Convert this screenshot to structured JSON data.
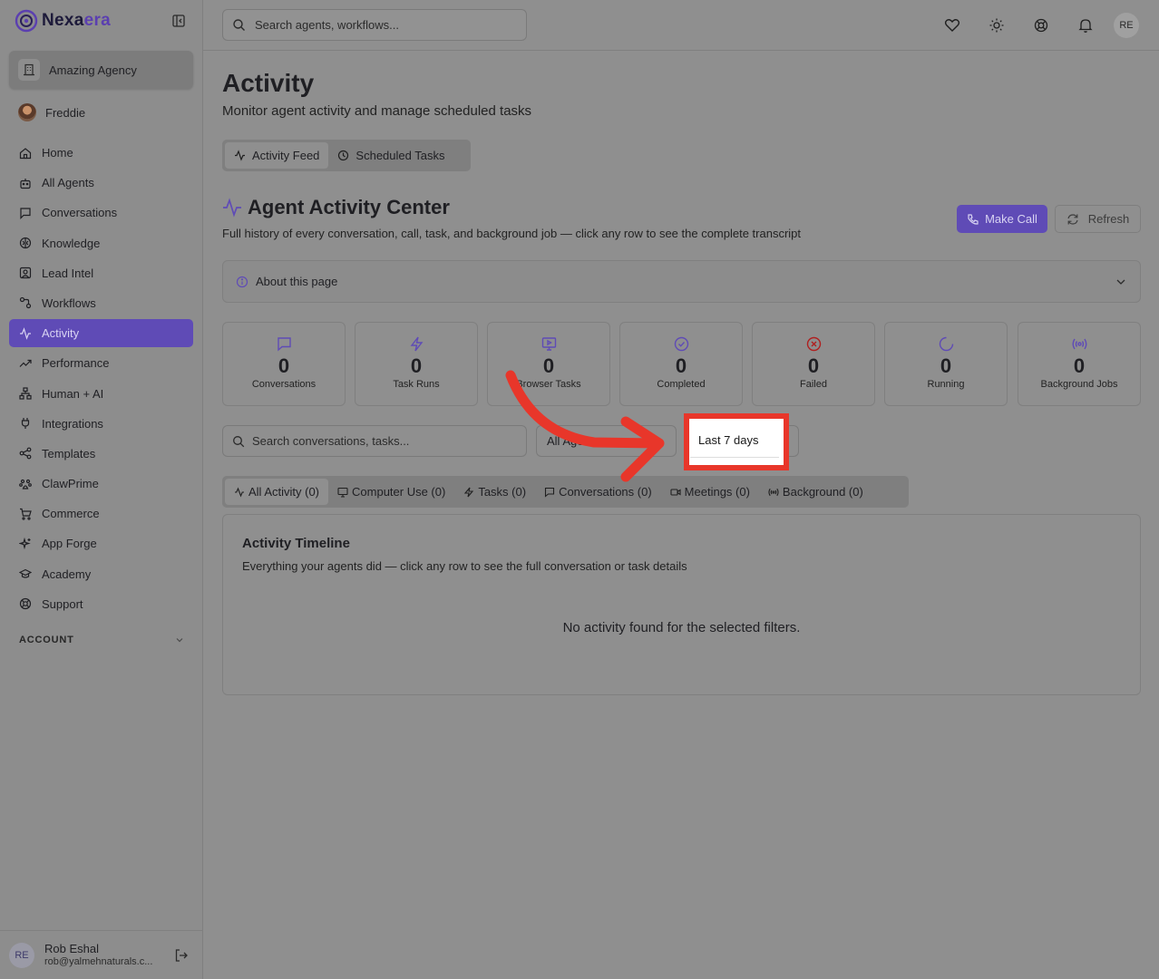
{
  "brand": {
    "name_part1": "Nexa",
    "name_part2": "era",
    "accent": "#5f4bb6"
  },
  "sidebar": {
    "agency_label": "Amazing Agency",
    "user_name": "Freddie",
    "items": [
      {
        "label": "Home",
        "icon": "home-icon"
      },
      {
        "label": "All Agents",
        "icon": "bot-icon"
      },
      {
        "label": "Conversations",
        "icon": "message-icon"
      },
      {
        "label": "Knowledge",
        "icon": "brain-icon"
      },
      {
        "label": "Lead Intel",
        "icon": "contact-icon"
      },
      {
        "label": "Workflows",
        "icon": "workflow-icon"
      },
      {
        "label": "Activity",
        "icon": "activity-icon",
        "active": true
      },
      {
        "label": "Performance",
        "icon": "trend-icon"
      },
      {
        "label": "Human + AI",
        "icon": "network-icon"
      },
      {
        "label": "Integrations",
        "icon": "plug-icon"
      },
      {
        "label": "Templates",
        "icon": "share-icon"
      },
      {
        "label": "ClawPrime",
        "icon": "paw-icon"
      },
      {
        "label": "Commerce",
        "icon": "cart-icon"
      },
      {
        "label": "App Forge",
        "icon": "sparkles-icon"
      },
      {
        "label": "Academy",
        "icon": "graduation-icon"
      },
      {
        "label": "Support",
        "icon": "lifebuoy-icon"
      }
    ],
    "account_label": "ACCOUNT",
    "footer": {
      "initials": "RE",
      "name": "Rob Eshal",
      "email": "rob@yalmehnaturals.c..."
    }
  },
  "topbar": {
    "search_placeholder": "Search agents, workflows...",
    "avatar_initials": "RE"
  },
  "page": {
    "title": "Activity",
    "subtitle": "Monitor agent activity and manage scheduled tasks",
    "tabs": [
      "Activity Feed",
      "Scheduled Tasks"
    ],
    "center_title": "Agent Activity Center",
    "center_subtitle": "Full history of every conversation, call, task, and background job — click any row to see the complete transcript",
    "make_call": "Make Call",
    "refresh": "Refresh",
    "about": "About this page",
    "stats": [
      {
        "value": "0",
        "label": "Conversations",
        "icon": "message-icon",
        "color": "#5f4bb6"
      },
      {
        "value": "0",
        "label": "Task Runs",
        "icon": "zap-icon",
        "color": "#5f4bb6"
      },
      {
        "value": "0",
        "label": "Browser Tasks",
        "icon": "monitor-icon",
        "color": "#5f4bb6"
      },
      {
        "value": "0",
        "label": "Completed",
        "icon": "check-circle-icon",
        "color": "#5f4bb6"
      },
      {
        "value": "0",
        "label": "Failed",
        "icon": "x-circle-icon",
        "color": "#b02020"
      },
      {
        "value": "0",
        "label": "Running",
        "icon": "loader-icon",
        "color": "#5f4bb6"
      },
      {
        "value": "0",
        "label": "Background Jobs",
        "icon": "radio-icon",
        "color": "#5f4bb6"
      }
    ],
    "filter_search_placeholder": "Search conversations, tasks...",
    "agent_filter": "All Agents",
    "date_filter": "Last 7 days",
    "sub_tabs": [
      "All Activity (0)",
      "Computer Use (0)",
      "Tasks (0)",
      "Conversations (0)",
      "Meetings (0)",
      "Background (0)"
    ],
    "timeline_title": "Activity Timeline",
    "timeline_subtitle": "Everything your agents did — click any row to see the full conversation or task details",
    "timeline_empty": "No activity found for the selected filters."
  },
  "annotation": {
    "highlight_color": "#e8362a"
  }
}
